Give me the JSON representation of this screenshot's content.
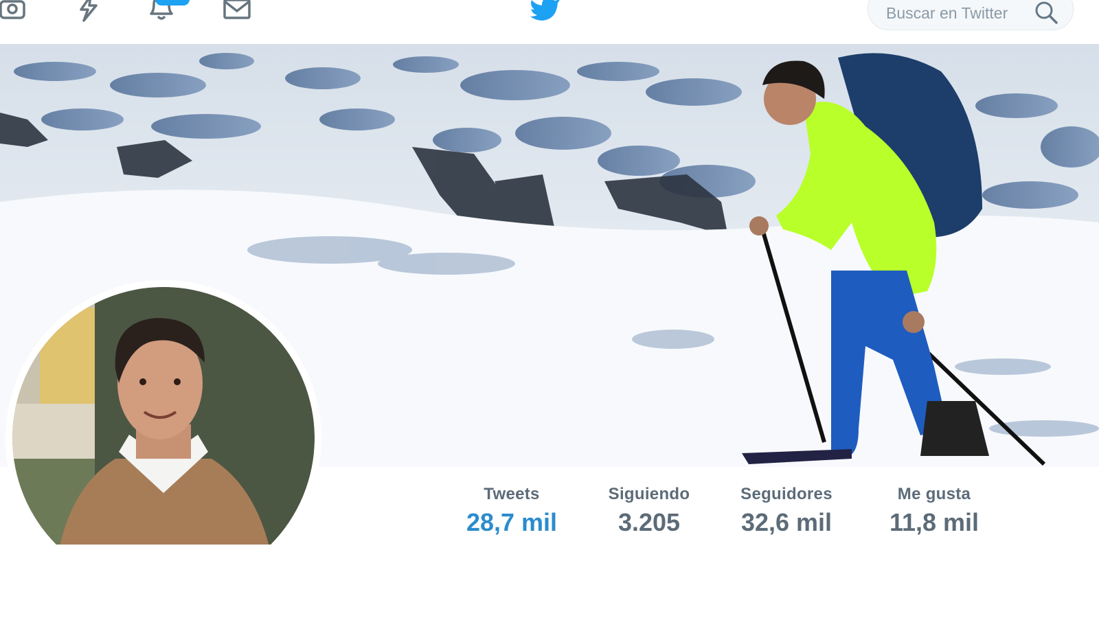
{
  "search": {
    "placeholder": "Buscar en Twitter"
  },
  "nav": {
    "icons": [
      "camera-icon",
      "moments-icon",
      "notifications-icon",
      "messages-icon"
    ],
    "logo": "twitter-bird-icon"
  },
  "profile": {
    "stats": [
      {
        "label": "Tweets",
        "value": "28,7 mil"
      },
      {
        "label": "Siguiendo",
        "value": "3.205"
      },
      {
        "label": "Seguidores",
        "value": "32,6 mil"
      },
      {
        "label": "Me gusta",
        "value": "11,8 mil"
      }
    ],
    "active_stat": "Tweets"
  },
  "colors": {
    "accent": "#1da1f2",
    "active_value": "#2b8ccd",
    "stat_text": "#5c6b78"
  }
}
